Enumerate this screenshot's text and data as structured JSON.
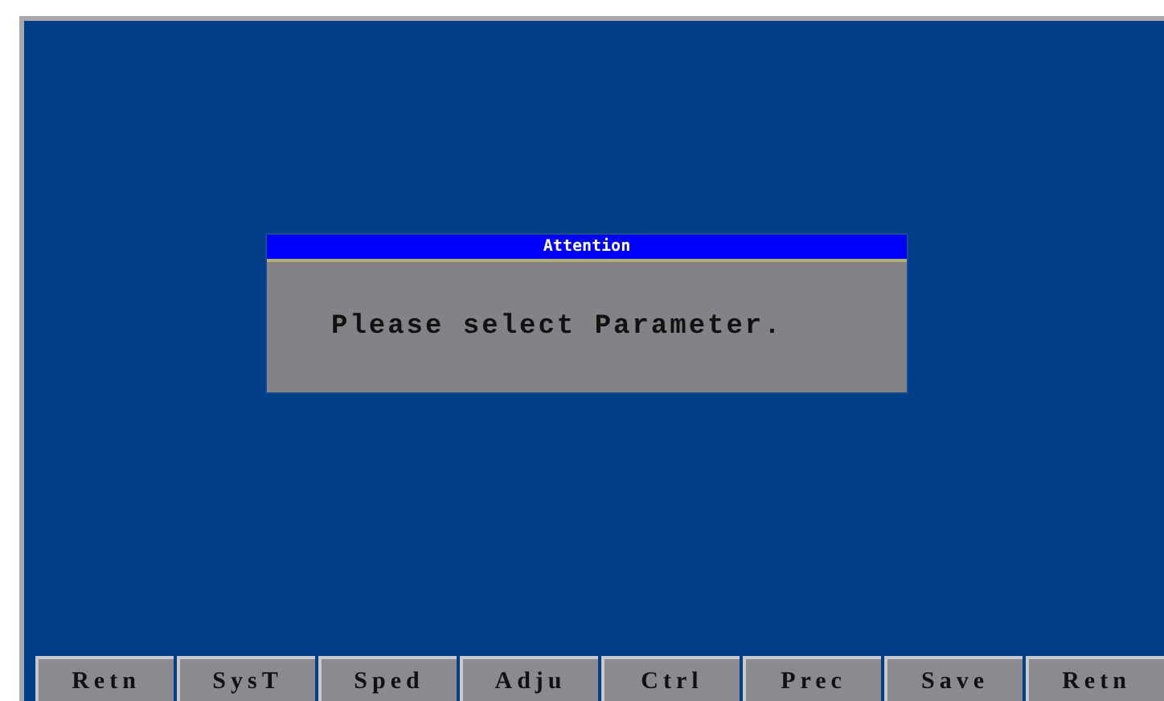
{
  "dialog": {
    "title": "Attention",
    "message": "Please select Parameter."
  },
  "softkeys": [
    "Retn",
    "SysT",
    "Sped",
    "Adju",
    "Ctrl",
    "Prec",
    "Save",
    "Retn"
  ]
}
